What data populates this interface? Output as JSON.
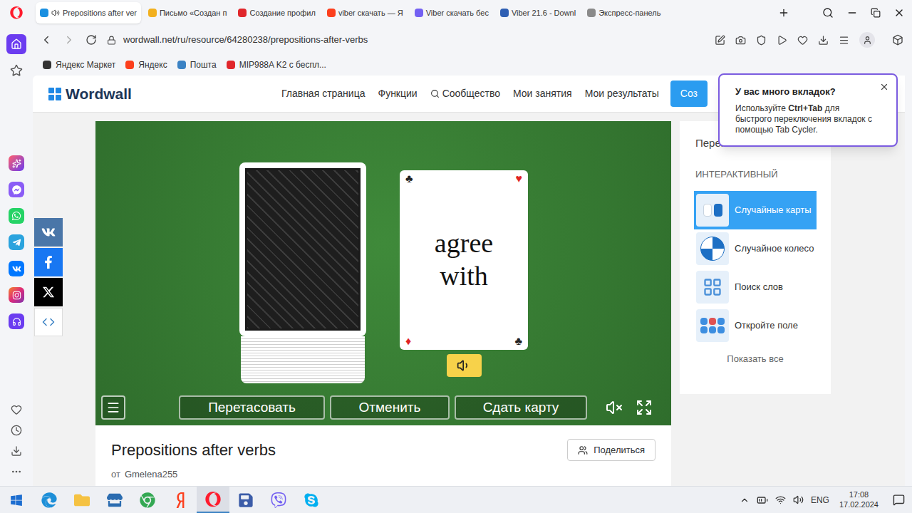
{
  "browser": {
    "tabs": [
      {
        "label": "Prepositions after ver",
        "selected": true,
        "audio": true,
        "color": "#1a8fe0"
      },
      {
        "label": "Письмо «Создан п",
        "selected": false,
        "audio": false,
        "color": "#f2b01e"
      },
      {
        "label": "Создание профил",
        "selected": false,
        "audio": false,
        "color": "#e0262b"
      },
      {
        "label": "viber скачать — Я",
        "selected": false,
        "audio": false,
        "color": "#fc3f1d"
      },
      {
        "label": "Viber скачать бес",
        "selected": false,
        "audio": false,
        "color": "#7360f2"
      },
      {
        "label": "Viber 21.6 - Downl",
        "selected": false,
        "audio": false,
        "color": "#2f5fb3"
      },
      {
        "label": "Экспресс-панель",
        "selected": false,
        "audio": false,
        "color": "#8a8a8a"
      }
    ],
    "url": "wordwall.net/ru/resource/64280238/prepositions-after-verbs",
    "bookmarks": [
      {
        "label": "Яндекс Маркет",
        "color": "#333333"
      },
      {
        "label": "Яндекс",
        "color": "#fc3f1d"
      },
      {
        "label": "Пошта",
        "color": "#3b82c4"
      },
      {
        "label": "MIP988A K2 с беспл...",
        "color": "#e0262b"
      }
    ]
  },
  "popup": {
    "title": "У вас много вкладок?",
    "segments": [
      {
        "text": "Используйте ",
        "bold": false
      },
      {
        "text": "Ctrl+Tab",
        "bold": true
      },
      {
        "text": " для быстрого переключения вкладок с помощью Tab Cycler.",
        "bold": false
      }
    ]
  },
  "site": {
    "logo": "Wordwall",
    "nav": [
      {
        "label": "Главная страница",
        "kind": "link"
      },
      {
        "label": "Функции",
        "kind": "link"
      },
      {
        "label": "Сообщество",
        "kind": "search"
      },
      {
        "label": "Мои занятия",
        "kind": "link"
      },
      {
        "label": "Мои результаты",
        "kind": "link"
      }
    ],
    "create_button": "Соз"
  },
  "game": {
    "card": {
      "lines": [
        "agree",
        "with"
      ],
      "corners": [
        {
          "suit": "♣",
          "color": "#222222"
        },
        {
          "suit": "♥",
          "color": "#e02424"
        },
        {
          "suit": "♦",
          "color": "#e02424"
        },
        {
          "suit": "♣",
          "color": "#222222"
        }
      ]
    },
    "buttons": [
      "Перетасовать",
      "Отменить",
      "Сдать карту"
    ],
    "muted": true
  },
  "templates": {
    "heading": "Переключить шаблон",
    "section": "ИНТЕРАКТИВНЫЙ",
    "items": [
      {
        "label": "Случайные карты",
        "selected": true,
        "kind": "cards"
      },
      {
        "label": "Случайное колесо",
        "selected": false,
        "kind": "wheel"
      },
      {
        "label": "Поиск слов",
        "selected": false,
        "kind": "wordsearch"
      },
      {
        "label": "Откройте поле",
        "selected": false,
        "kind": "openbox"
      }
    ],
    "show_all": "Показать все"
  },
  "activity": {
    "title": "Prepositions after verbs",
    "share": "Поделиться",
    "author_prefix": "от",
    "author": "Gmelena255"
  },
  "taskbar": {
    "apps": [
      {
        "kind": "edge",
        "active": false
      },
      {
        "kind": "explorer",
        "active": false
      },
      {
        "kind": "store",
        "active": false
      },
      {
        "kind": "chrome",
        "active": false
      },
      {
        "kind": "yandex",
        "active": false
      },
      {
        "kind": "opera",
        "active": true
      },
      {
        "kind": "save",
        "active": false
      },
      {
        "kind": "viber",
        "active": false
      },
      {
        "kind": "skype",
        "active": false
      }
    ],
    "language": "ENG",
    "time": "17:08",
    "date": "17.02.2024"
  }
}
